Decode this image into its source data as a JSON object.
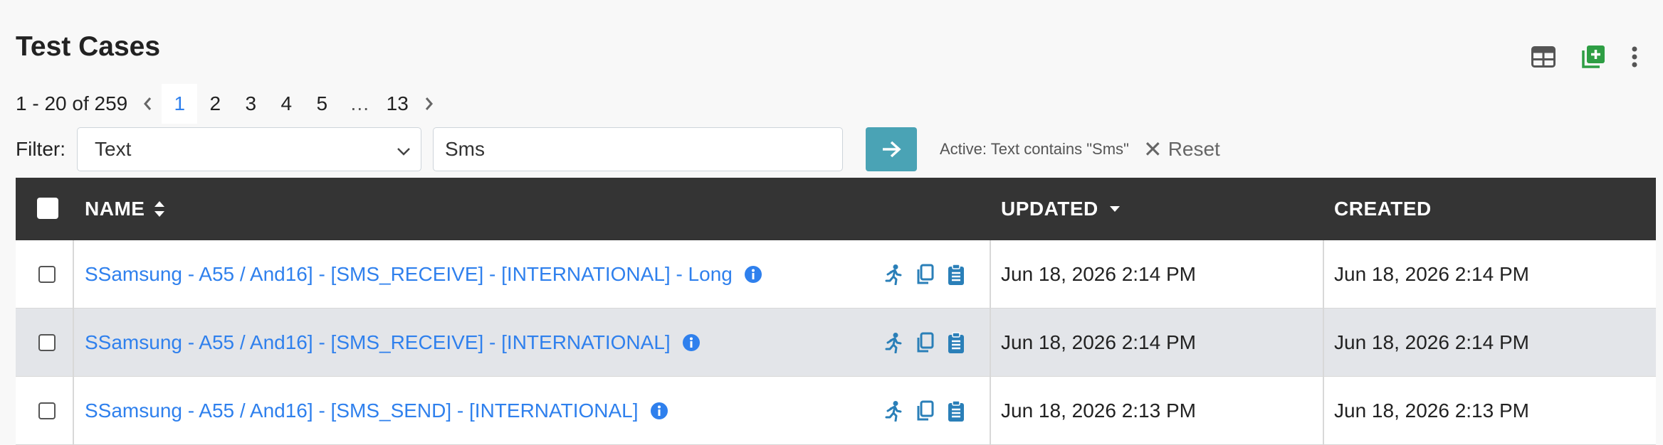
{
  "page": {
    "title": "Test Cases"
  },
  "toolbar": {
    "icons": [
      "table-columns-icon",
      "add-box-icon",
      "more-vertical-icon"
    ],
    "accent_add": "#2e9e44"
  },
  "pagination": {
    "range_text": "1 - 20 of 259",
    "pages": [
      "1",
      "2",
      "3",
      "4",
      "5"
    ],
    "ellipsis": "…",
    "last_page": "13",
    "active_page": "1",
    "active_color": "#2f80ed"
  },
  "filter": {
    "label": "Filter:",
    "field_value": "Text",
    "input_value": "Sms",
    "active_text": "Active: Text contains \"Sms\"",
    "reset_label": "Reset",
    "go_color": "#4aa3b5"
  },
  "table": {
    "columns": {
      "name": "NAME",
      "updated": "UPDATED",
      "created": "CREATED"
    },
    "sort": {
      "name": "sortable",
      "updated": "descending"
    },
    "rows": [
      {
        "name": "SSamsung - A55 / And16] - [SMS_RECEIVE] - [INTERNATIONAL] - Long",
        "updated": "Jun 18, 2026 2:14 PM",
        "created": "Jun 18, 2026 2:14 PM"
      },
      {
        "name": "SSamsung - A55 / And16] - [SMS_RECEIVE] - [INTERNATIONAL]",
        "updated": "Jun 18, 2026 2:14 PM",
        "created": "Jun 18, 2026 2:14 PM"
      },
      {
        "name": "SSamsung - A55 / And16] - [SMS_SEND] - [INTERNATIONAL]",
        "updated": "Jun 18, 2026 2:13 PM",
        "created": "Jun 18, 2026 2:13 PM"
      }
    ],
    "row_icons": [
      "run-icon",
      "copy-icon",
      "clipboard-icon"
    ],
    "link_color": "#2f80ed",
    "action_color": "#2a7fb8"
  }
}
